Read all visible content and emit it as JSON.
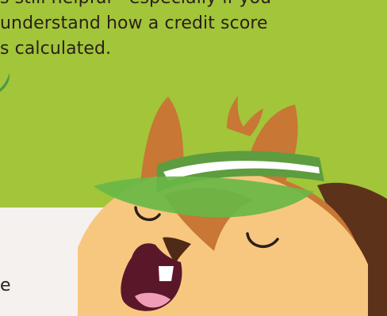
{
  "hero": {
    "line1": "s still helpful—especially if you",
    "line2": "understand how a credit score",
    "line3": "s calculated.",
    "background_color": "#a2c53a"
  },
  "lower_panel": {
    "partial_letter": "e",
    "background_color": "#f4f1ee"
  },
  "mascot": {
    "description_icon": "squirrel-with-visor-icon"
  }
}
